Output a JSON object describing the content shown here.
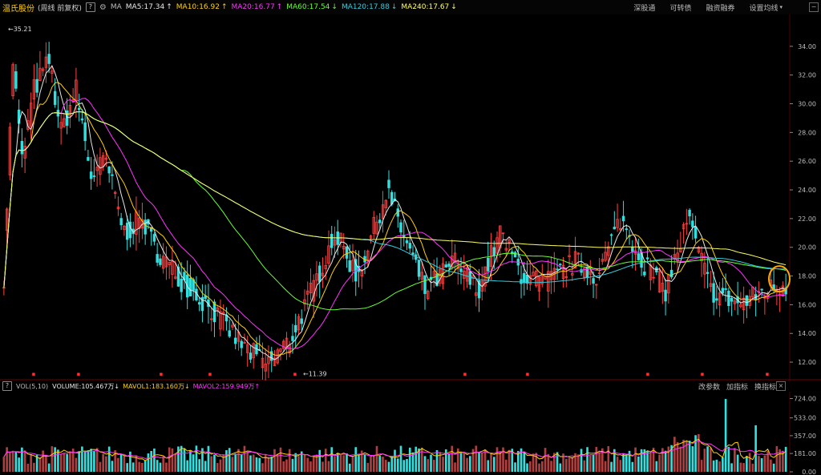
{
  "header": {
    "stock_name": "温氏股份",
    "mode": "(周线 前复权)",
    "help": "?",
    "ma_label": "MA",
    "ma": [
      {
        "label": "MA5:17.34",
        "arrow": "↑",
        "color": "#e8e8e8"
      },
      {
        "label": "MA10:16.92",
        "arrow": "↑",
        "color": "#ffd000"
      },
      {
        "label": "MA20:16.77",
        "arrow": "↑",
        "color": "#ff33ff"
      },
      {
        "label": "MA60:17.54",
        "arrow": "↓",
        "color": "#66ff33"
      },
      {
        "label": "MA120:17.88",
        "arrow": "↓",
        "color": "#33ccdd"
      },
      {
        "label": "MA240:17.67",
        "arrow": "↓",
        "color": "#ffff66"
      }
    ],
    "links": [
      "深股通",
      "可转债",
      "融资融券",
      "设置均线"
    ],
    "caret": "▾",
    "minimize": "−"
  },
  "price_axis": {
    "ticks": [
      "34.00",
      "32.00",
      "30.00",
      "28.00",
      "26.00",
      "24.00",
      "22.00",
      "20.00",
      "18.00",
      "16.00",
      "14.00",
      "12.00"
    ],
    "high_label": "35.21",
    "low_label": "11.39",
    "high_arrow": "←",
    "low_arrow": "←"
  },
  "volume_header": {
    "help": "?",
    "label": "VOL(5,10)",
    "volume": "VOLUME:105.467万",
    "volume_arrow": "↓",
    "mavol1": "MAVOL1:183.160万",
    "mavol1_arrow": "↓",
    "mavol2": "MAVOL2:159.949万",
    "mavol2_arrow": "↑",
    "buttons": [
      "改参数",
      "加指标",
      "换指标"
    ],
    "close": "×"
  },
  "volume_axis": {
    "ticks": [
      "724.00",
      "533.00",
      "357.00",
      "181.00",
      "0.00"
    ]
  },
  "colors": {
    "up": "#ff4040",
    "down": "#33e0e0",
    "ma5": "#e8e8e8",
    "ma10": "#ffd000",
    "ma20": "#ff33ff",
    "ma60": "#66ff33",
    "ma120": "#33ccdd",
    "ma240": "#ffff66",
    "highlight": "#ffaa00"
  }
}
